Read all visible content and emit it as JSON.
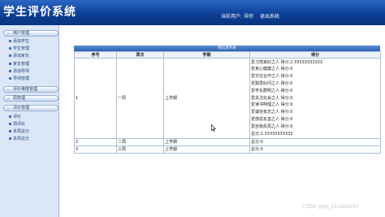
{
  "header": {
    "title": "学生评价系统",
    "current_user_label": "当前用户:",
    "current_user": "导师",
    "logout": "退出系统"
  },
  "sidebar": {
    "sections": [
      {
        "label": "用户管理",
        "items": [
          "添加学生",
          "学生管理",
          "添加家长",
          "家长管理",
          "添加导师",
          "导师管理"
        ]
      },
      {
        "label": "评价维度管理",
        "items": []
      },
      {
        "label": "周管理",
        "items": []
      },
      {
        "label": "评价管理",
        "items": [
          "评价",
          "周评价",
          "本周总分",
          "本周总分"
        ]
      }
    ]
  },
  "table": {
    "title": "周信息列表",
    "headers": [
      "序号",
      "周次",
      "学期",
      "得分"
    ],
    "rows": [
      {
        "no": "1",
        "week": "一周",
        "term": "上学期",
        "scores": [
          "爱习惯良好之人 得分:2.33333333333",
          "爱身心健康之人 得分:0",
          "爱交往合作之人 得分:0",
          "爱勤思好问之人 得分:0",
          "爱学长群明之人 得分:0",
          "爱关注社会之人 得分:0",
          "爱读书明理之人 得分:0",
          "爱诚信有志之人 得分:0",
          "爱感恩友善之人 得分:0",
          "爱自我反思之人 得分:0",
          "总分:2.33333333333"
        ]
      },
      {
        "no": "2",
        "week": "二周",
        "term": "上学期",
        "scores": [
          "总分:0"
        ]
      },
      {
        "no": "3",
        "week": "三周",
        "term": "上学期",
        "scores": [
          "总分:0"
        ]
      }
    ]
  },
  "watermark": "CSDN @qq_251836457"
}
